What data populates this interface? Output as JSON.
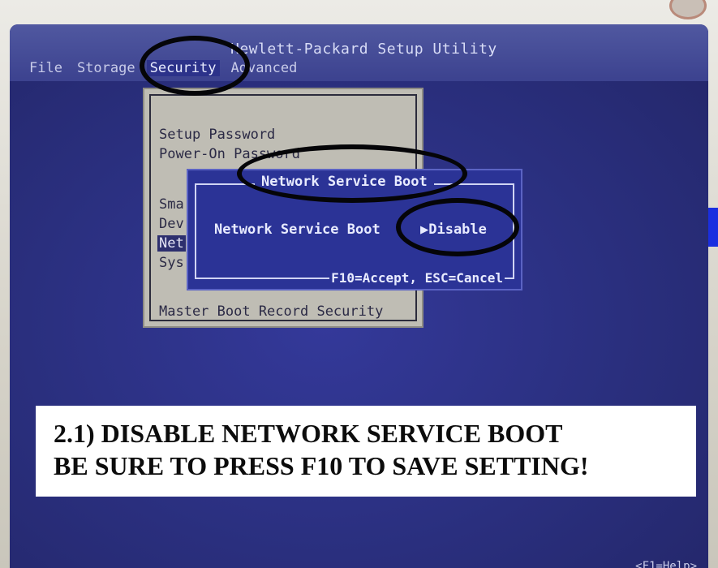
{
  "app": {
    "title": "Hewlett-Packard Setup Utility"
  },
  "menubar": {
    "items": [
      "File",
      "Storage",
      "Security",
      "Advanced"
    ]
  },
  "security_menu": {
    "items": [
      "Setup Password",
      "Power-On Password",
      "Sma",
      "Dev",
      "Net",
      "Sys",
      "Master Boot Record Security"
    ]
  },
  "dialog": {
    "title": "Network Service Boot",
    "field_label": "Network Service Boot",
    "field_value": "▶Disable",
    "footer": "F10=Accept, ESC=Cancel"
  },
  "caption": {
    "line1": "2.1) DISABLE NETWORK SERVICE BOOT",
    "line2": "BE SURE TO PRESS F10 TO SAVE SETTING!"
  },
  "status": {
    "help_hint": "<F1=Help>"
  },
  "colors": {
    "screen_bg": "#2a2f7e",
    "dialog_bg": "#2b3396",
    "menu_bg": "#bfbdb4",
    "annotation": "#050508"
  }
}
